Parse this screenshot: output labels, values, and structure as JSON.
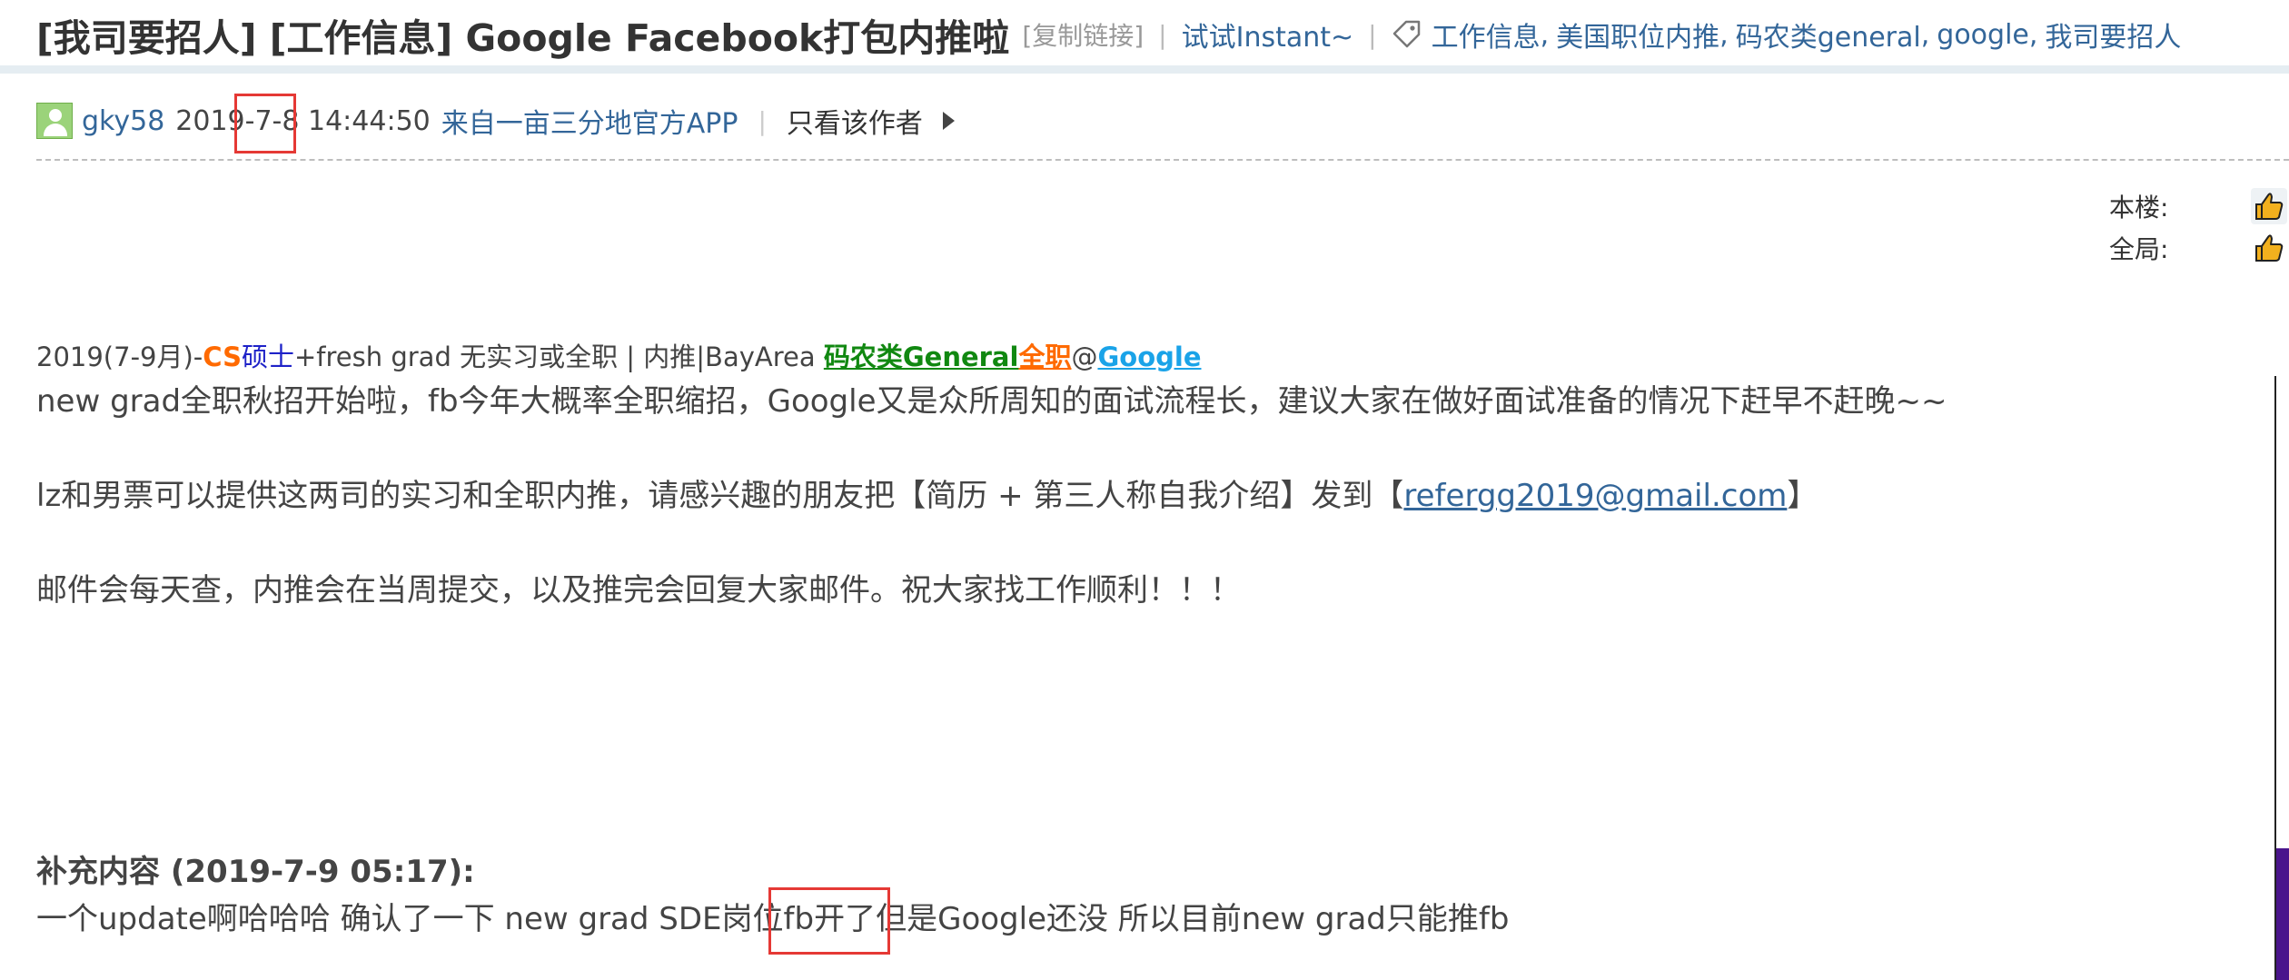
{
  "header": {
    "title": "[我司要招人] [工作信息] Google Facebook打包内推啦",
    "copy_link": "[复制链接]",
    "sep1": "|",
    "try_instant": "试试Instant~",
    "sep2": "|",
    "tag_icon": "tag-icon",
    "tags": [
      "工作信息",
      "美国职位内推",
      "码农类general",
      "google",
      "我司要招人"
    ],
    "tag_separator": ","
  },
  "author": {
    "avatar": "avatar-icon",
    "name": "gky58",
    "time_prefix": "2019",
    "time_date": "-7-8",
    "time_suffix": " 14:44:50",
    "source": "来自一亩三分地官方APP",
    "separator": "|",
    "only_author": "只看该作者",
    "arrow_icon": "triangle-right-icon"
  },
  "rating": {
    "this_floor_label": "本楼:",
    "global_label": "全局:",
    "thumb_icon": "thumbs-up-icon"
  },
  "post": {
    "thread_label": {
      "prefix": "2019(7-9月)-",
      "cs": "CS",
      "masters": "硕士",
      "middle": "+fresh grad 无实习或全职 | 内推|BayArea ",
      "general": "码农类General",
      "fulltime": "全职",
      "at": "@",
      "company": "Google"
    },
    "line1": "new grad全职秋招开始啦，fb今年大概率全职缩招，Google又是众所周知的面试流程长，建议大家在做好面试准备的情况下赶早不赶晚~~",
    "line2_before": "lz和男票可以提供这两司的实习和全职内推，请感兴趣的朋友把【简历 + 第三人称自我介绍】发到【",
    "line2_email": "refergg2019@gmail.com",
    "line2_after": "】",
    "line3": "邮件会每天查，内推会在当周提交，以及推完会回复大家邮件。祝大家找工作顺利！！！",
    "supplement_title": "补充内容 (2019-7-9 05:17):",
    "supplement_before": "一个update啊哈哈哈 确认了一下 new grad SDE岗",
    "supplement_highlight": "位fb开了",
    "supplement_after": "但是Google还没 所以目前new grad只能推fb"
  },
  "colors": {
    "link": "#336699",
    "highlight_box": "#e53935",
    "cs_orange": "#ff6a00",
    "masters_blue": "#1e22c8",
    "general_green": "#118811",
    "google_blue": "#1aa3e8"
  }
}
